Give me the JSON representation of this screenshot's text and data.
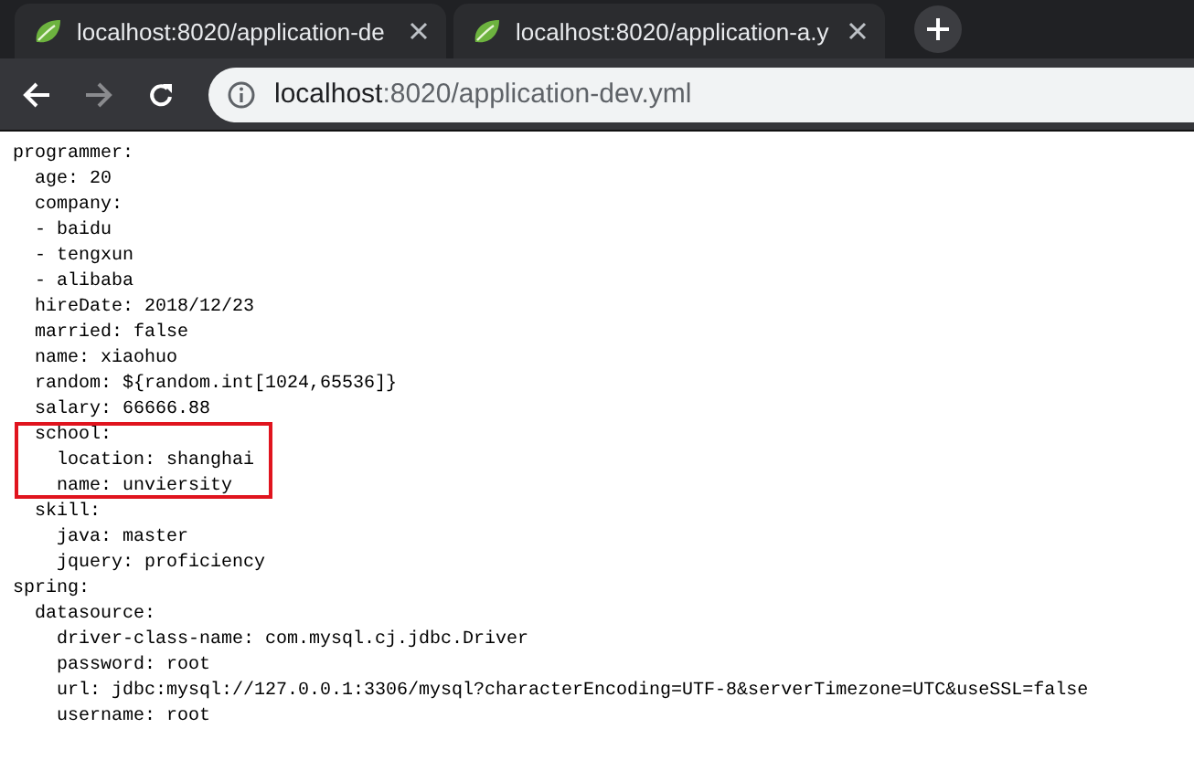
{
  "tabs": [
    {
      "title": "localhost:8020/application-de"
    },
    {
      "title": "localhost:8020/application-a.y"
    }
  ],
  "address": {
    "host": "localhost",
    "path": ":8020/application-dev.yml"
  },
  "document": [
    {
      "text": "programmer:",
      "children": [
        {
          "text": "age: 20"
        },
        {
          "text": "company:"
        },
        {
          "text": "- baidu"
        },
        {
          "text": "- tengxun"
        },
        {
          "text": "- alibaba"
        },
        {
          "text": "hireDate: 2018/12/23"
        },
        {
          "text": "married: false"
        },
        {
          "text": "name: xiaohuo"
        },
        {
          "text": "random: ${random.int[1024,65536]}"
        },
        {
          "text": "salary: 66666.88"
        },
        {
          "text": "school:",
          "highlighted": true,
          "children": [
            {
              "text": "location: shanghai"
            },
            {
              "text": "name: unviersity"
            }
          ]
        },
        {
          "text": "skill:",
          "children": [
            {
              "text": "java: master"
            },
            {
              "text": "jquery: proficiency"
            }
          ]
        }
      ]
    },
    {
      "text": "spring:",
      "children": [
        {
          "text": "datasource:",
          "children": [
            {
              "text": "driver-class-name: com.mysql.cj.jdbc.Driver"
            },
            {
              "text": "password: root"
            },
            {
              "text": "url: jdbc:mysql://127.0.0.1:3306/mysql?characterEncoding=UTF-8&serverTimezone=UTC&useSSL=false"
            },
            {
              "text": "username: root"
            }
          ]
        }
      ]
    }
  ]
}
